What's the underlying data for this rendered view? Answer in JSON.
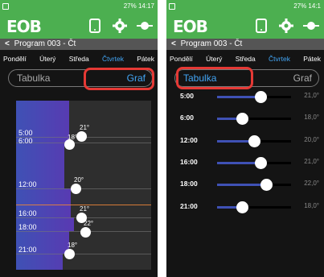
{
  "status": {
    "text": "27% 14:17",
    "text_right": "27% 14:1"
  },
  "app": {
    "logo": "EOB",
    "title": "Program 003 - Čt",
    "back_icon": "chevron-left-icon",
    "icons": [
      "tablet-icon",
      "gear-icon",
      "plug-icon"
    ],
    "accent": "#4caf50",
    "active_color": "#42a5f5"
  },
  "days": [
    "Pondělí",
    "Úterý",
    "Středa",
    "Čtvrtek",
    "Pátek"
  ],
  "active_day": "Čtvrtek",
  "tabs": {
    "table": "Tabulka",
    "graph": "Graf"
  },
  "schedule": [
    {
      "time": "5:00",
      "temp": "21,0°",
      "value": 21
    },
    {
      "time": "6:00",
      "temp": "18,0°",
      "value": 18
    },
    {
      "time": "12:00",
      "temp": "20,0°",
      "value": 20
    },
    {
      "time": "16:00",
      "temp": "21,0°",
      "value": 21
    },
    {
      "time": "18:00",
      "temp": "22,0°",
      "value": 22
    },
    {
      "time": "21:00",
      "temp": "18,0°",
      "value": 18
    }
  ],
  "graph_temps": [
    "21°",
    "18°",
    "20°",
    "21°",
    "22°",
    "18°"
  ]
}
